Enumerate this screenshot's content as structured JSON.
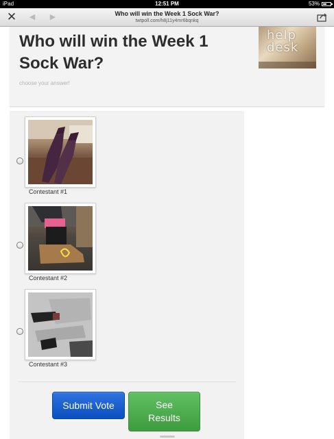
{
  "status_bar": {
    "carrier": "iPad",
    "time": "12:51 PM",
    "battery": "53%",
    "battery_level": 0.53
  },
  "browser": {
    "page_title": "Who will win the Week 1 Sock War?",
    "url": "twtpoll.com/h8j11y4mr6bqnkq",
    "close_icon": "close-icon",
    "back_icon": "back-arrow-icon",
    "forward_icon": "forward-arrow-icon",
    "share_icon": "share-icon"
  },
  "poll": {
    "question": "Who will win the Week 1 Sock War?",
    "instruction": "choose your answer!",
    "logo_text": [
      "help",
      "desk"
    ],
    "options": [
      {
        "label": "Contestant #1"
      },
      {
        "label": "Contestant #2"
      },
      {
        "label": "Contestant #3"
      }
    ]
  },
  "actions": {
    "submit_label": "Submit Vote",
    "results_label": "See Results"
  },
  "colors": {
    "submit_button": "#1b5fd0",
    "results_button": "#4fae4f",
    "panel_background": "#f2f2f2"
  }
}
